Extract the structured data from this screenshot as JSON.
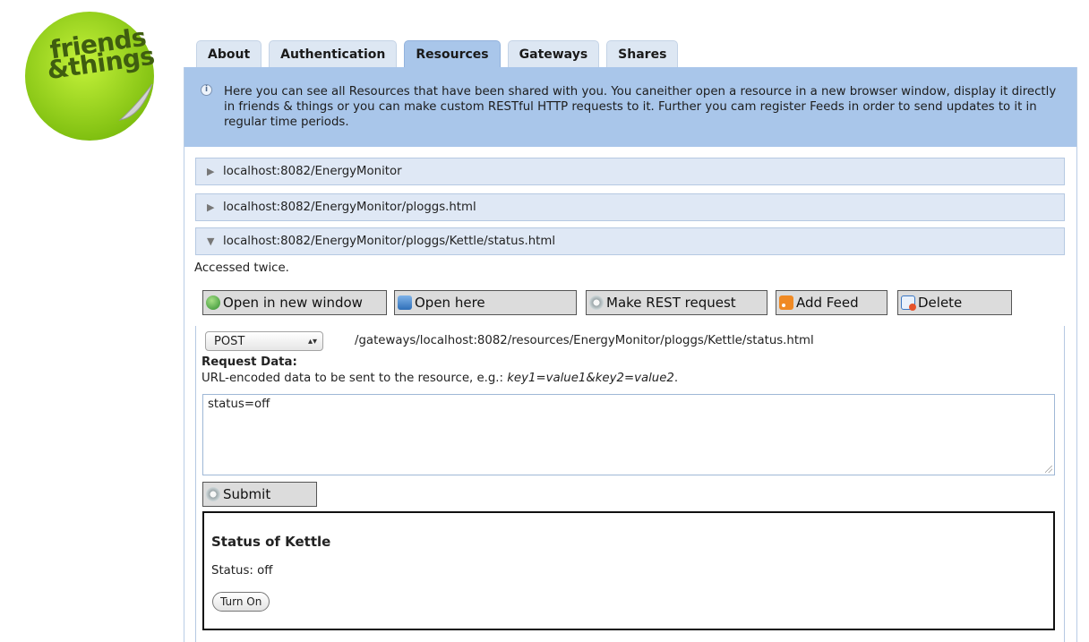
{
  "logo": {
    "line1": "friends",
    "line2": "&things"
  },
  "tabs": [
    {
      "label": "About"
    },
    {
      "label": "Authentication"
    },
    {
      "label": "Resources"
    },
    {
      "label": "Gateways"
    },
    {
      "label": "Shares"
    }
  ],
  "active_tab": "Resources",
  "info": {
    "text": "Here you can see all Resources that have been shared with you. You caneither open a resource in a new browser window, display it directly in friends & things or you can make custom RESTful HTTP requests to it. Further you cam register Feeds in order to send updates to it in regular time periods."
  },
  "resources": [
    {
      "url": "localhost:8082/EnergyMonitor",
      "expanded": false
    },
    {
      "url": "localhost:8082/EnergyMonitor/ploggs.html",
      "expanded": false
    },
    {
      "url": "localhost:8082/EnergyMonitor/ploggs/Kettle/status.html",
      "expanded": true
    }
  ],
  "expanded": {
    "accessed": "Accessed twice.",
    "buttons": {
      "open_new_window": "Open in new window",
      "open_here": "Open here",
      "make_rest": "Make REST request",
      "add_feed": "Add Feed",
      "delete": "Delete"
    },
    "method": "POST",
    "path": "/gateways/localhost:8082/resources/EnergyMonitor/ploggs/Kettle/status.html",
    "request_label": "Request Data:",
    "request_help_prefix": "URL-encoded data to be sent to the resource, e.g.: ",
    "request_help_example": "key1=value1&key2=value2",
    "request_help_suffix": ".",
    "request_data": "status=off",
    "submit": "Submit",
    "result": {
      "title": "Status of Kettle",
      "status": "Status: off",
      "button": "Turn On"
    }
  }
}
